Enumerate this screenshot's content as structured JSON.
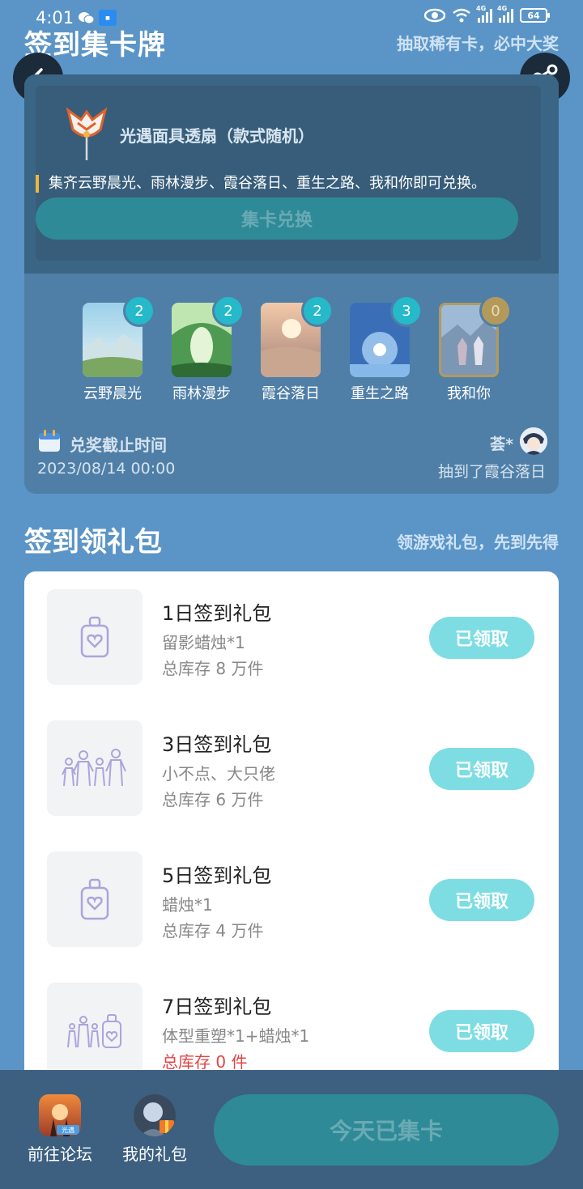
{
  "status_bar": {
    "time": "4:01",
    "signal_tag_1": "4G",
    "signal_tag_2": "4G",
    "battery": "64",
    "icons": [
      "wechat-icon",
      "app-notification-icon",
      "eye-icon",
      "wifi-icon",
      "signal-icon",
      "signal-icon",
      "battery-icon"
    ]
  },
  "header": {
    "title": "签到集卡牌",
    "subtitle": "抽取稀有卡，必中大奖",
    "back_icon": "chevron-left-icon",
    "share_icon": "share-icon"
  },
  "prize": {
    "name": "光遇面具透扇（款式随机）",
    "description": "集齐云野晨光、雨林漫步、霞谷落日、重生之路、我和你即可兑换。",
    "exchange_label": "集卡兑换"
  },
  "cards": [
    {
      "label": "云野晨光",
      "count": "2"
    },
    {
      "label": "雨林漫步",
      "count": "2"
    },
    {
      "label": "霞谷落日",
      "count": "2"
    },
    {
      "label": "重生之路",
      "count": "3"
    },
    {
      "label": "我和你",
      "count": "0"
    }
  ],
  "deadline": {
    "title": "兑奖截止时间",
    "date": "2023/08/14 00:00"
  },
  "winner": {
    "name": "荟*",
    "text": "抽到了霞谷落日"
  },
  "signin": {
    "title": "签到领礼包",
    "subtitle": "领游戏礼包，先到先得",
    "gifts": [
      {
        "title": "1日签到礼包",
        "item": "留影蜡烛*1",
        "stock": "总库存 8 万件",
        "button": "已领取",
        "icon": "candle-icon"
      },
      {
        "title": "3日签到礼包",
        "item": "小不点、大只佬",
        "stock": "总库存 6 万件",
        "button": "已领取",
        "icon": "people-icon"
      },
      {
        "title": "5日签到礼包",
        "item": "蜡烛*1",
        "stock": "总库存 4 万件",
        "button": "已领取",
        "icon": "candle-icon"
      },
      {
        "title": "7日签到礼包",
        "item": "体型重塑*1+蜡烛*1",
        "stock": "总库存 0 件",
        "button": "已领取",
        "icon": "people-candle-icon"
      }
    ]
  },
  "bottom": {
    "forum_label": "前往论坛",
    "forum_badge": "光遇",
    "gifts_label": "我的礼包",
    "checkin_label": "今天已集卡"
  },
  "colors": {
    "background": "#5b95c7",
    "accent_teal": "#25b9c9",
    "claimed_button": "#7ddde3",
    "stock_empty": "#e04545"
  }
}
